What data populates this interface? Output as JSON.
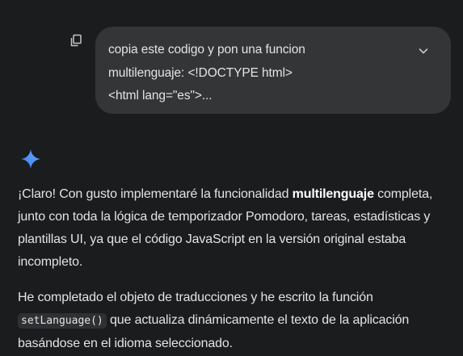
{
  "user_message": {
    "text": "copia este codigo y pon una funcion\nmultilenguaje: <!DOCTYPE html>\n<html lang=\"es\">...",
    "copy_icon": "copy-icon",
    "expand_icon": "chevron-down-icon"
  },
  "assistant": {
    "logo_icon": "gemini-sparkle-icon",
    "p1": {
      "before": "¡Claro! Con gusto implementaré la funcionalidad ",
      "bold": "multilenguaje",
      "after": " completa, junto con toda la lógica de temporizador Pomodoro, tareas, estadísticas y plantillas UI, ya que el código JavaScript en la versión original estaba incompleto."
    },
    "p2": {
      "before": "He completado el objeto de traducciones y he escrito la función ",
      "code": "setLanguage()",
      "after": " que actualiza dinámicamente el texto de la aplicación basándose en el idioma seleccionado."
    }
  },
  "colors": {
    "background": "#1b1c1d",
    "bubble": "#333537",
    "text": "#e3e3e3",
    "gemini_blue": "#4c8df6"
  }
}
